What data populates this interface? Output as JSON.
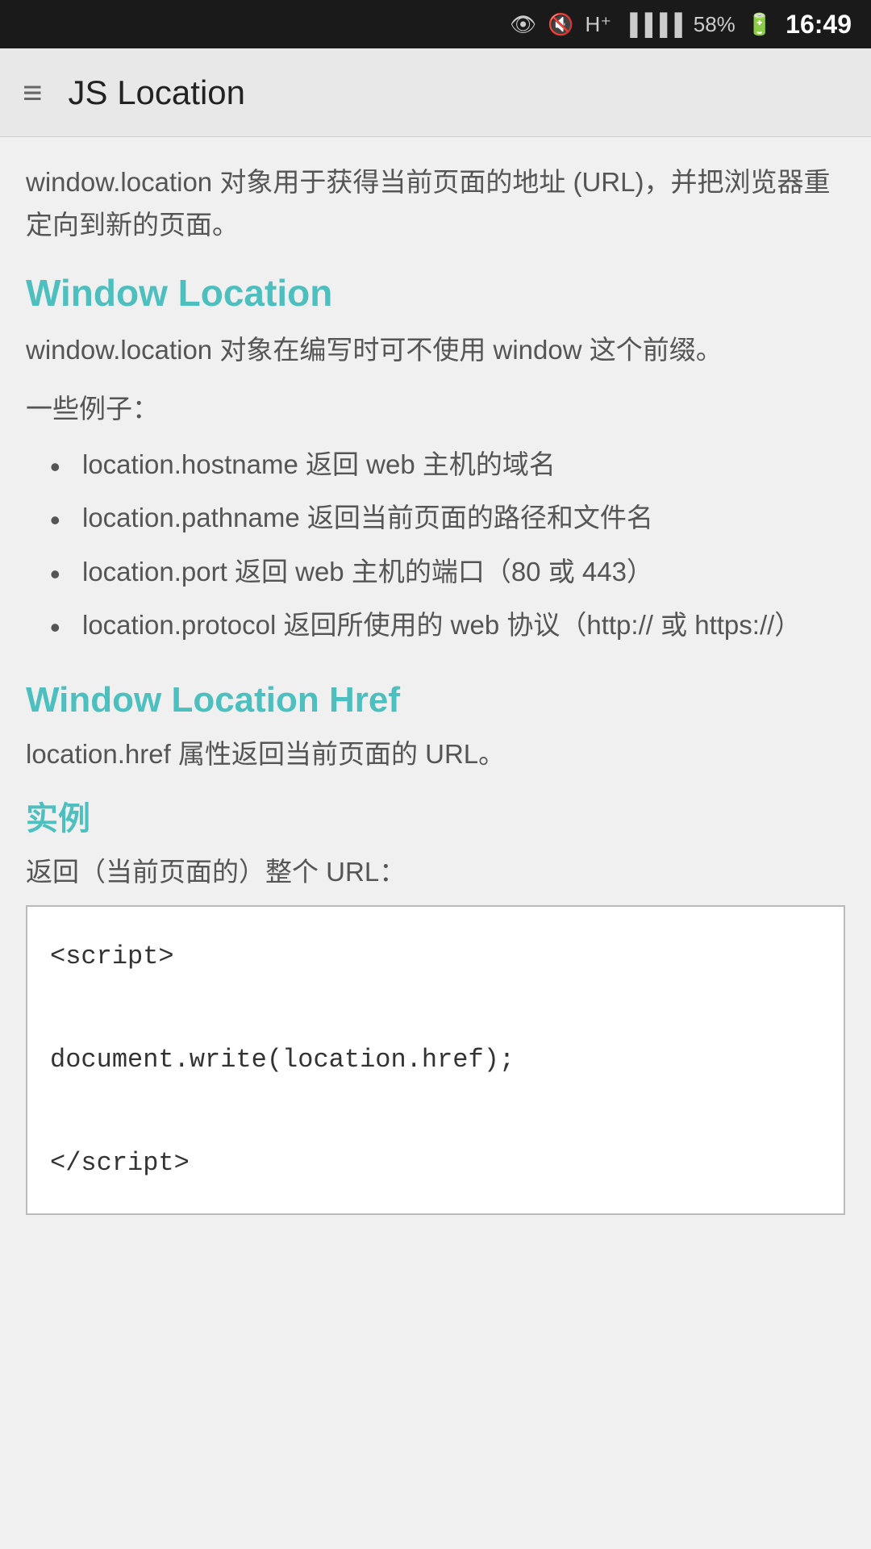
{
  "status_bar": {
    "battery_percent": "58%",
    "time": "16:49"
  },
  "app_bar": {
    "title": "JS Location",
    "menu_icon": "≡"
  },
  "content": {
    "intro": "window.location 对象用于获得当前页面的地址 (URL)，并把浏览器重定向到新的页面。",
    "section1": {
      "title": "Window Location",
      "description": "window.location 对象在编写时可不使用 window 这个前缀。",
      "examples_label": "一些例子：",
      "bullet_items": [
        "location.hostname 返回 web 主机的域名",
        "location.pathname 返回当前页面的路径和文件名",
        "location.port 返回 web 主机的端口（80 或 443）",
        "location.protocol 返回所使用的 web 协议（http:// 或 https://）"
      ]
    },
    "section2": {
      "title": "Window Location Href",
      "description": "location.href 属性返回当前页面的 URL。",
      "example_title": "实例",
      "example_desc": "返回（当前页面的）整个 URL：",
      "code": "<script>\n\ndocument.write(location.href);\n\n</script>"
    }
  }
}
